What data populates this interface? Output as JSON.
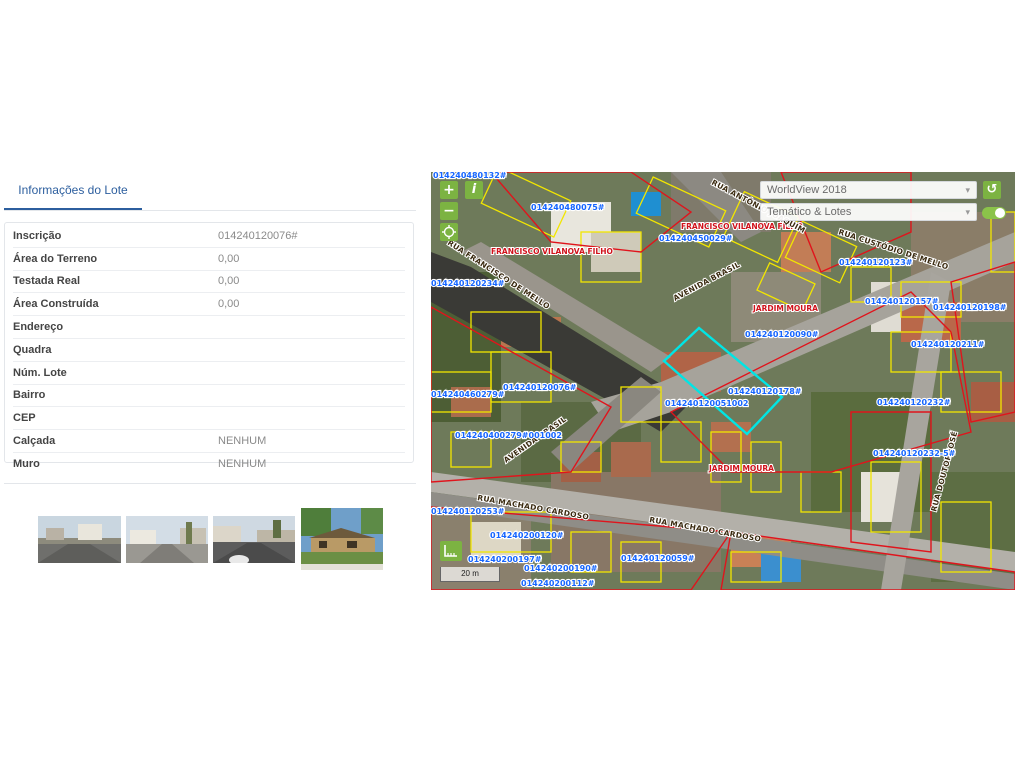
{
  "tabs": {
    "active": "Informações do Lote"
  },
  "lot_info": [
    {
      "label": "Inscrição",
      "value": "014240120076#"
    },
    {
      "label": "Área do Terreno",
      "value": "0,00"
    },
    {
      "label": "Testada Real",
      "value": "0,00"
    },
    {
      "label": "Área Construída",
      "value": "0,00"
    },
    {
      "label": "Endereço",
      "value": ""
    },
    {
      "label": "Quadra",
      "value": ""
    },
    {
      "label": "Núm. Lote",
      "value": ""
    },
    {
      "label": "Bairro",
      "value": ""
    },
    {
      "label": "CEP",
      "value": ""
    },
    {
      "label": "Calçada",
      "value": "NENHUM"
    },
    {
      "label": "Muro",
      "value": "NENHUM"
    }
  ],
  "photos": [
    {
      "icon": "street-photo-1"
    },
    {
      "icon": "street-photo-2"
    },
    {
      "icon": "street-photo-3"
    },
    {
      "icon": "house-photo"
    }
  ],
  "map": {
    "controls": {
      "zoom_in": "+",
      "zoom_out": "−",
      "info": "i",
      "reset_icon": "↺"
    },
    "basemap_select": "WorldView 2018",
    "overlay_select": "Temático & Lotes",
    "scale": "20 m",
    "parcel_labels": [
      "014240480132#",
      "014240480075#",
      "014240450029#",
      "014240120123#",
      "014240120157#",
      "014240120198#",
      "014240120090#",
      "014240120211#",
      "014240120178#",
      "014240120076#",
      "014240120051002",
      "014240120232#",
      "014240120234#",
      "014240480075#",
      "014240400279#001002",
      "014240460279#",
      "014240200190#",
      "014240200197#",
      "014240200120#",
      "014240120059#",
      "014240200112#",
      "014240120232-5#",
      "014240120253#"
    ],
    "place_labels": [
      "FRANCISCO VILANOVA FILHO",
      "FRANCISCO VILANOVA FILHO",
      "JARDIM MOURA",
      "JARDIM MOURA"
    ],
    "street_labels": [
      "RUA FRANCISCO DE MELLO",
      "AVENIDA BRASIL",
      "RUA CUSTÓDIO DE MELLO",
      "RUA MACHADO CARDOSO",
      "RUA MACHADO CARDOSO",
      "AVENIDA BRASIL",
      "RUA ANTÔNIO JOAQUIM",
      "RUA DOUTOR JOSÉ"
    ]
  }
}
